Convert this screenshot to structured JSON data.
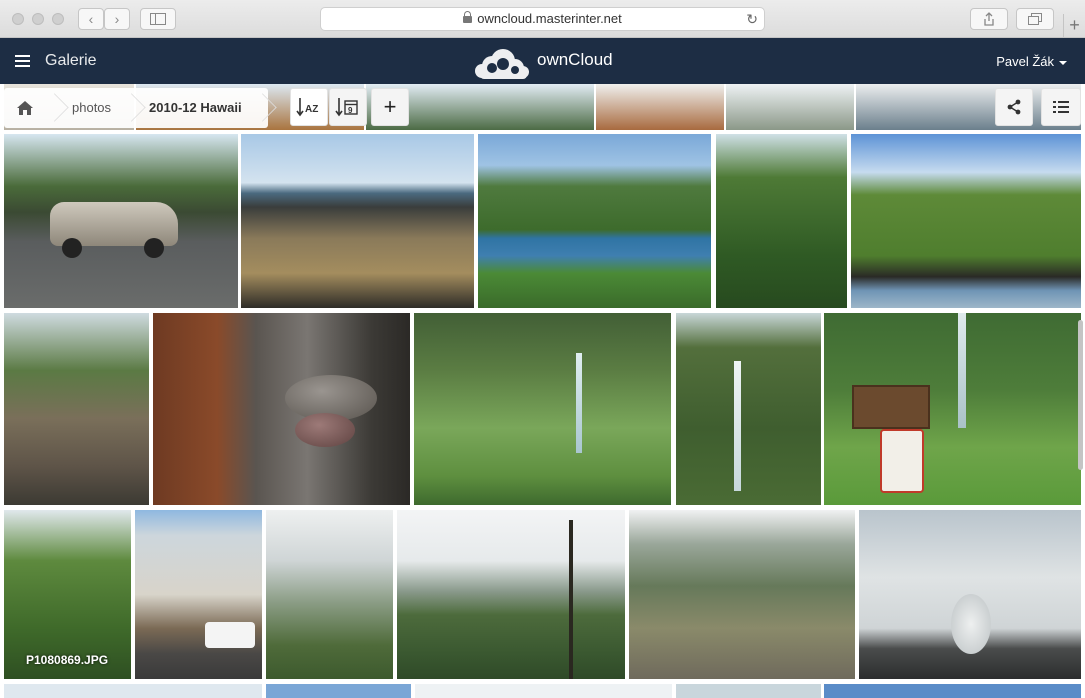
{
  "browser": {
    "url": "owncloud.masterinter.net",
    "back_glyph": "‹",
    "forward_glyph": "›",
    "reload_glyph": "↻",
    "new_tab_glyph": "+"
  },
  "header": {
    "app_name": "Galerie",
    "brand": "ownCloud",
    "user_name": "Pavel Žák"
  },
  "breadcrumb": {
    "items": [
      "photos",
      "2010-12 Hawaii"
    ]
  },
  "toolbar": {
    "sort_name_label": "AZ",
    "sort_date_label": "9",
    "add_label": "+"
  },
  "photos": {
    "labeled_filename": "P1080869.JPG"
  },
  "colors": {
    "header_bg": "#1d2d44",
    "accent": "#ffffff"
  }
}
